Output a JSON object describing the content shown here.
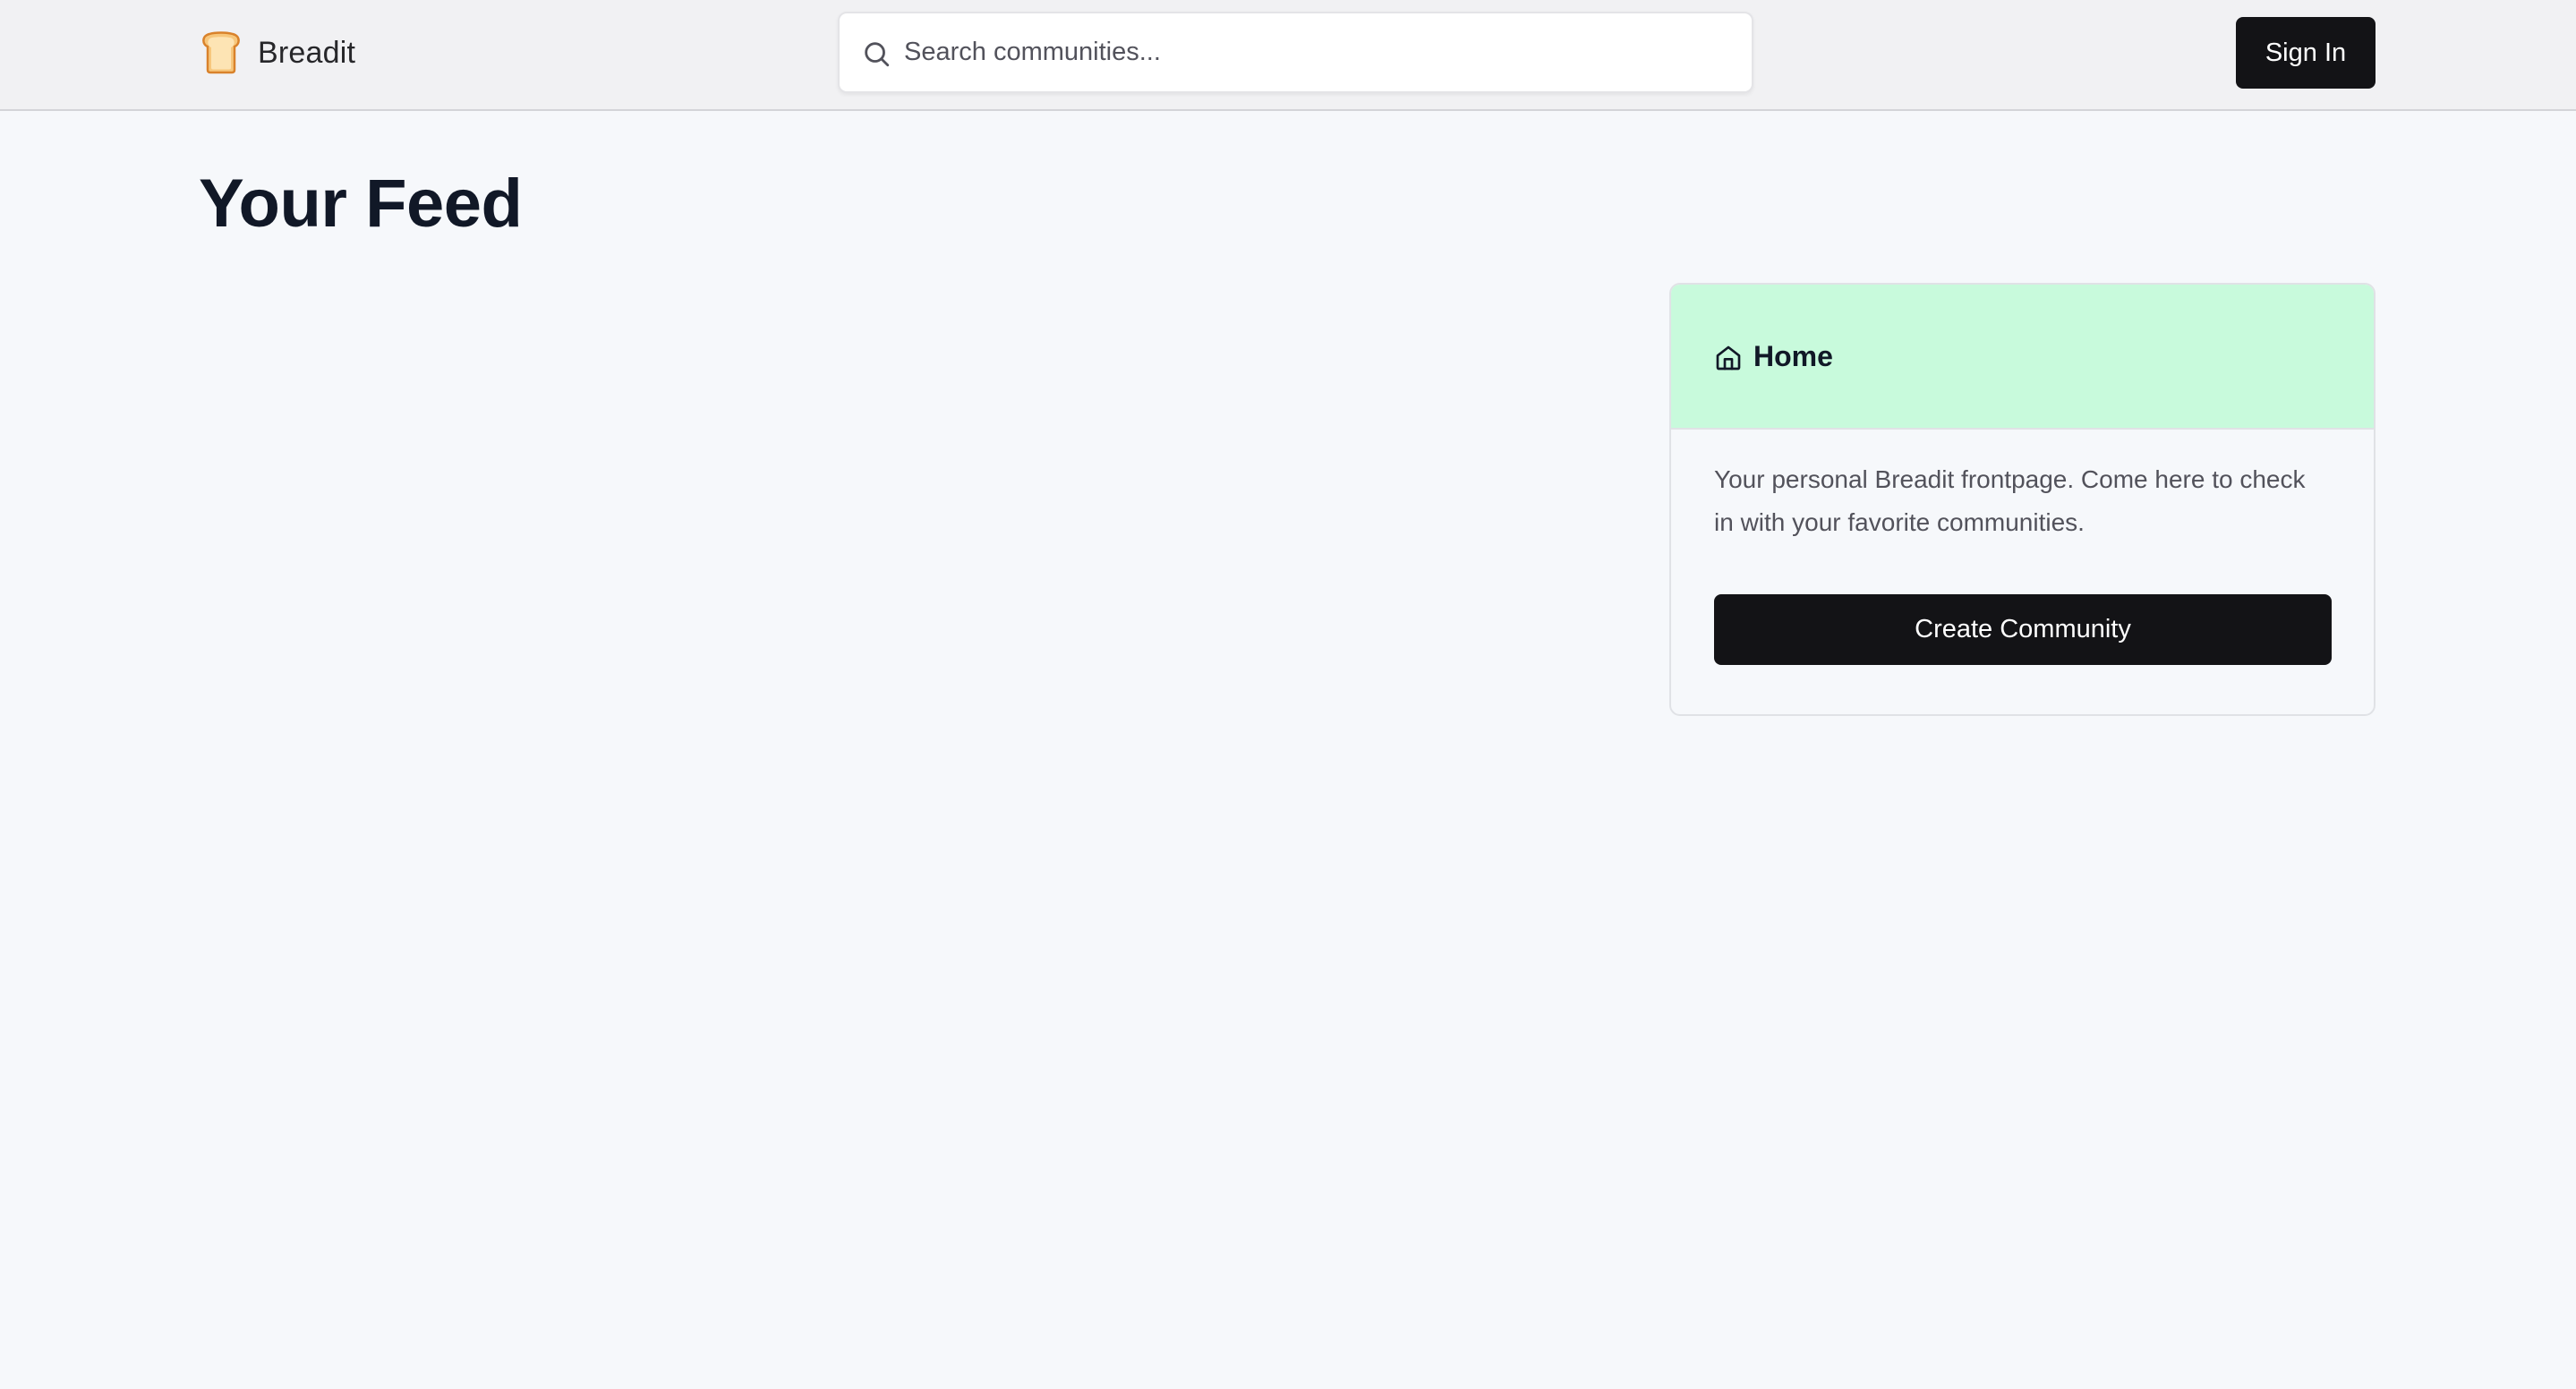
{
  "navbar": {
    "brand_name": "Breadit",
    "logo_icon": "bread-slice-icon",
    "search": {
      "placeholder": "Search communities...",
      "value": ""
    },
    "sign_in_label": "Sign In"
  },
  "main": {
    "title": "Your Feed"
  },
  "home_card": {
    "title": "Home",
    "description": "Your personal Breadit frontpage. Come here to check in with your favorite communities.",
    "create_button_label": "Create Community",
    "header_color": "#c8fadc"
  },
  "colors": {
    "primary_button": "#131316",
    "page_background": "#f6f8fb",
    "navbar_background": "#f1f1f3"
  }
}
